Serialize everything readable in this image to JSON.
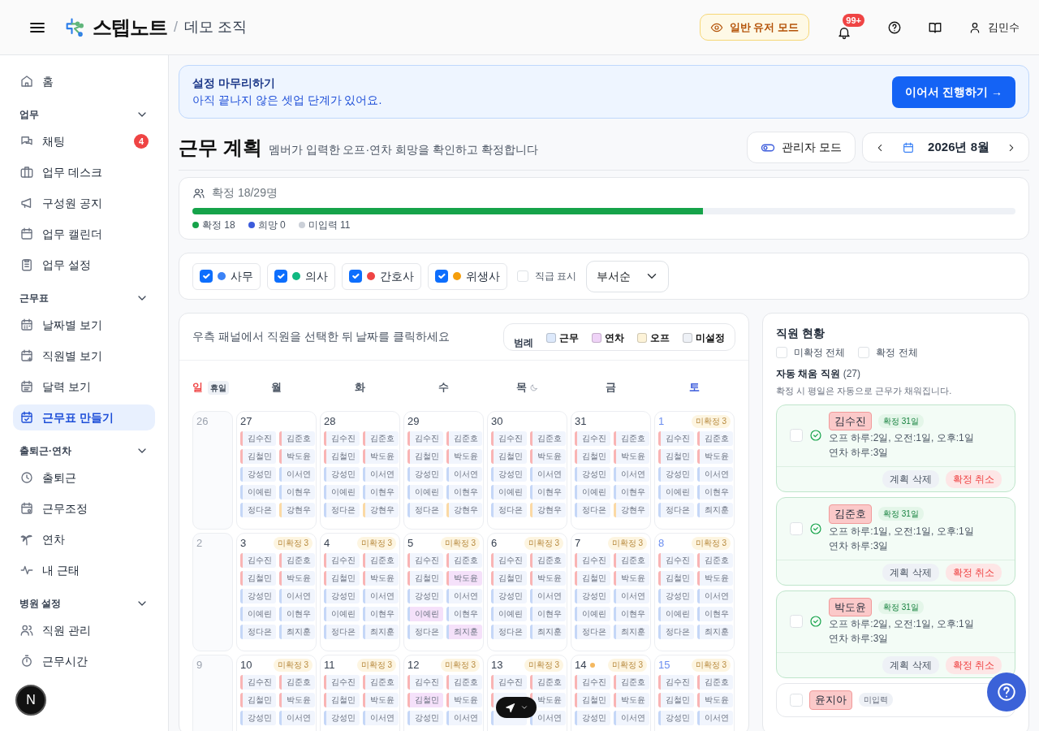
{
  "header": {
    "brand": "스텝노트",
    "separator": "/",
    "org": "데모 조직",
    "mode_button": "일반 유저 모드",
    "notifications": "99+",
    "user": "김민수"
  },
  "sidebar": [
    {
      "items": [
        {
          "label": "홈",
          "selected": false
        }
      ]
    },
    {
      "title": "업무",
      "expanded": true,
      "items": [
        {
          "label": "채팅",
          "selected": false,
          "badge": "4"
        },
        {
          "label": "업무 데스크",
          "selected": false
        },
        {
          "label": "구성원 공지",
          "selected": false
        },
        {
          "label": "업무 캘린더",
          "selected": false
        },
        {
          "label": "업무 설정",
          "selected": false
        }
      ]
    },
    {
      "title": "근무표",
      "expanded": true,
      "items": [
        {
          "label": "날짜별 보기",
          "selected": false
        },
        {
          "label": "직원별 보기",
          "selected": false
        },
        {
          "label": "달력 보기",
          "selected": false
        },
        {
          "label": "근무표 만들기",
          "selected": true
        }
      ]
    },
    {
      "title": "출퇴근·연차",
      "expanded": true,
      "items": [
        {
          "label": "출퇴근",
          "selected": false
        },
        {
          "label": "근무조정",
          "selected": false
        },
        {
          "label": "연차",
          "selected": false
        },
        {
          "label": "내 근태",
          "selected": false
        }
      ]
    },
    {
      "title": "병원 설정",
      "expanded": true,
      "items": [
        {
          "label": "직원 관리",
          "selected": false
        },
        {
          "label": "근무시간",
          "selected": false
        }
      ]
    }
  ],
  "dev_badge": "N",
  "banner": {
    "title": "설정 마무리하기",
    "text": "아직 끝나지 않은 셋업 단계가 있어요.",
    "button": "이어서 진행하기 →"
  },
  "page": {
    "title": "근무 계획",
    "subtitle": "멤버가 입력한 오프·연차 희망을 확인하고 확정합니다",
    "admin_button": "관리자 모드",
    "month": "2026년 8월"
  },
  "progress": {
    "label": "확정 18/29명",
    "level": 0.62,
    "legend": [
      {
        "label": "확정 18",
        "color": "#16a34a"
      },
      {
        "label": "희망 0",
        "color": "#3b5bdb"
      },
      {
        "label": "미입력 11",
        "color": "#cbd0d8"
      }
    ]
  },
  "filters": [
    {
      "label": "사무",
      "color": "#3b82f6",
      "checked": true
    },
    {
      "label": "의사",
      "color": "#10b981",
      "checked": true
    },
    {
      "label": "간호사",
      "color": "#ef4444",
      "checked": true
    },
    {
      "label": "위생사",
      "color": "#f59e0b",
      "checked": true
    }
  ],
  "show_rank": {
    "label": "직급 표시",
    "checked": false
  },
  "sort": "부서순",
  "calendar": {
    "hint": "우측 패널에서 직원을 선택한 뒤 날짜를 클릭하세요",
    "legend_title": "범례",
    "legend": [
      {
        "label": "근무",
        "color": "#dde9fb"
      },
      {
        "label": "연차",
        "color": "#efd3f7"
      },
      {
        "label": "오프",
        "color": "#fdf3d8"
      },
      {
        "label": "미설정",
        "color": "#eef1f6"
      }
    ],
    "weekdays": [
      {
        "label": "일",
        "kind": "sun",
        "tag": "휴일"
      },
      {
        "label": "월",
        "kind": "day"
      },
      {
        "label": "화",
        "kind": "day"
      },
      {
        "label": "수",
        "kind": "day"
      },
      {
        "label": "목",
        "kind": "night"
      },
      {
        "label": "금",
        "kind": "day"
      },
      {
        "label": "토",
        "kind": "sat"
      }
    ],
    "weeks": [
      [
        {
          "date": "26",
          "kind": "sun"
        },
        {
          "date": "27",
          "kind": "day",
          "chips": [
            {
              "name": "김수진",
              "color": "#f9b4b4",
              "kind": "work"
            },
            {
              "name": "김준호",
              "color": "#f9b4b4",
              "kind": "work"
            },
            {
              "name": "김철민",
              "color": "#f9b4b4",
              "kind": "work"
            },
            {
              "name": "박도윤",
              "color": "#f9b4b4",
              "kind": "work"
            },
            {
              "name": "강성민",
              "color": "#c5d7f7",
              "kind": "work"
            },
            {
              "name": "이서연",
              "color": "#c5d7f7",
              "kind": "work"
            },
            {
              "name": "이예린",
              "color": "#c5d7f7",
              "kind": "work"
            },
            {
              "name": "이현우",
              "color": "#c5d7f7",
              "kind": "work"
            },
            {
              "name": "정다은",
              "color": "#c5d7f7",
              "kind": "work"
            },
            {
              "name": "강현우",
              "color": "#fbd9a4",
              "kind": "work"
            }
          ]
        },
        {
          "date": "28",
          "kind": "day",
          "chips": [
            {
              "name": "김수진",
              "color": "#f9b4b4",
              "kind": "work"
            },
            {
              "name": "김준호",
              "color": "#f9b4b4",
              "kind": "work"
            },
            {
              "name": "김철민",
              "color": "#f9b4b4",
              "kind": "work"
            },
            {
              "name": "박도윤",
              "color": "#f9b4b4",
              "kind": "work"
            },
            {
              "name": "강성민",
              "color": "#c5d7f7",
              "kind": "work"
            },
            {
              "name": "이서연",
              "color": "#c5d7f7",
              "kind": "work"
            },
            {
              "name": "이예린",
              "color": "#c5d7f7",
              "kind": "work"
            },
            {
              "name": "이현우",
              "color": "#c5d7f7",
              "kind": "work"
            },
            {
              "name": "정다은",
              "color": "#c5d7f7",
              "kind": "work"
            },
            {
              "name": "강현우",
              "color": "#fbd9a4",
              "kind": "work"
            }
          ]
        },
        {
          "date": "29",
          "kind": "day",
          "chips": [
            {
              "name": "김수진",
              "color": "#f9b4b4",
              "kind": "work"
            },
            {
              "name": "김준호",
              "color": "#f9b4b4",
              "kind": "work"
            },
            {
              "name": "김철민",
              "color": "#f9b4b4",
              "kind": "work"
            },
            {
              "name": "박도윤",
              "color": "#f9b4b4",
              "kind": "work"
            },
            {
              "name": "강성민",
              "color": "#c5d7f7",
              "kind": "work"
            },
            {
              "name": "이서연",
              "color": "#c5d7f7",
              "kind": "work"
            },
            {
              "name": "이예린",
              "color": "#c5d7f7",
              "kind": "work"
            },
            {
              "name": "이현우",
              "color": "#c5d7f7",
              "kind": "work"
            },
            {
              "name": "정다은",
              "color": "#c5d7f7",
              "kind": "work"
            },
            {
              "name": "강현우",
              "color": "#fbd9a4",
              "kind": "work"
            }
          ]
        },
        {
          "date": "30",
          "kind": "day",
          "chips": [
            {
              "name": "김수진",
              "color": "#f9b4b4",
              "kind": "work"
            },
            {
              "name": "김준호",
              "color": "#f9b4b4",
              "kind": "work"
            },
            {
              "name": "김철민",
              "color": "#f9b4b4",
              "kind": "work"
            },
            {
              "name": "박도윤",
              "color": "#f9b4b4",
              "kind": "work"
            },
            {
              "name": "강성민",
              "color": "#c5d7f7",
              "kind": "work"
            },
            {
              "name": "이서연",
              "color": "#c5d7f7",
              "kind": "work"
            },
            {
              "name": "이예린",
              "color": "#c5d7f7",
              "kind": "work"
            },
            {
              "name": "이현우",
              "color": "#c5d7f7",
              "kind": "work"
            },
            {
              "name": "정다은",
              "color": "#c5d7f7",
              "kind": "work"
            },
            {
              "name": "강현우",
              "color": "#fbd9a4",
              "kind": "work"
            }
          ]
        },
        {
          "date": "31",
          "kind": "day",
          "chips": [
            {
              "name": "김수진",
              "color": "#f9b4b4",
              "kind": "work"
            },
            {
              "name": "김준호",
              "color": "#f9b4b4",
              "kind": "work"
            },
            {
              "name": "김철민",
              "color": "#f9b4b4",
              "kind": "work"
            },
            {
              "name": "박도윤",
              "color": "#f9b4b4",
              "kind": "work"
            },
            {
              "name": "강성민",
              "color": "#c5d7f7",
              "kind": "work"
            },
            {
              "name": "이서연",
              "color": "#c5d7f7",
              "kind": "work"
            },
            {
              "name": "이예린",
              "color": "#c5d7f7",
              "kind": "work"
            },
            {
              "name": "이현우",
              "color": "#c5d7f7",
              "kind": "work"
            },
            {
              "name": "정다은",
              "color": "#c5d7f7",
              "kind": "work"
            },
            {
              "name": "강현우",
              "color": "#fbd9a4",
              "kind": "work"
            }
          ]
        },
        {
          "date": "1",
          "kind": "sat",
          "badge": "미확정 3",
          "chips": [
            {
              "name": "김수진",
              "color": "#f9b4b4",
              "kind": "work"
            },
            {
              "name": "김준호",
              "color": "#f9b4b4",
              "kind": "work"
            },
            {
              "name": "김철민",
              "color": "#f9b4b4",
              "kind": "work"
            },
            {
              "name": "박도윤",
              "color": "#f9b4b4",
              "kind": "work"
            },
            {
              "name": "강성민",
              "color": "#c5d7f7",
              "kind": "work"
            },
            {
              "name": "이서연",
              "color": "#c5d7f7",
              "kind": "work"
            },
            {
              "name": "이예린",
              "color": "#c5d7f7",
              "kind": "work"
            },
            {
              "name": "이현우",
              "color": "#c5d7f7",
              "kind": "work"
            },
            {
              "name": "정다은",
              "color": "#c5d7f7",
              "kind": "work"
            },
            {
              "name": "최지훈",
              "color": "#c5d7f7",
              "kind": "work"
            }
          ]
        }
      ],
      [
        {
          "date": "2",
          "kind": "sun"
        },
        {
          "date": "3",
          "kind": "day",
          "badge": "미확정 3",
          "chips": [
            {
              "name": "김수진",
              "color": "#f9b4b4",
              "kind": "work"
            },
            {
              "name": "김준호",
              "color": "#f9b4b4",
              "kind": "work"
            },
            {
              "name": "김철민",
              "color": "#f9b4b4",
              "kind": "work"
            },
            {
              "name": "박도윤",
              "color": "#f9b4b4",
              "kind": "work"
            },
            {
              "name": "강성민",
              "color": "#c5d7f7",
              "kind": "work"
            },
            {
              "name": "이서연",
              "color": "#c5d7f7",
              "kind": "work"
            },
            {
              "name": "이예린",
              "color": "#c5d7f7",
              "kind": "work"
            },
            {
              "name": "이현우",
              "color": "#c5d7f7",
              "kind": "work"
            },
            {
              "name": "정다은",
              "color": "#c5d7f7",
              "kind": "work"
            },
            {
              "name": "최지훈",
              "color": "#c5d7f7",
              "kind": "work"
            }
          ]
        },
        {
          "date": "4",
          "kind": "day",
          "badge": "미확정 3",
          "chips": [
            {
              "name": "김수진",
              "color": "#f9b4b4",
              "kind": "work"
            },
            {
              "name": "김준호",
              "color": "#f9b4b4",
              "kind": "work"
            },
            {
              "name": "김철민",
              "color": "#f9b4b4",
              "kind": "work"
            },
            {
              "name": "박도윤",
              "color": "#f9b4b4",
              "kind": "work"
            },
            {
              "name": "강성민",
              "color": "#c5d7f7",
              "kind": "work"
            },
            {
              "name": "이서연",
              "color": "#c5d7f7",
              "kind": "work"
            },
            {
              "name": "이예린",
              "color": "#c5d7f7",
              "kind": "work"
            },
            {
              "name": "이현우",
              "color": "#c5d7f7",
              "kind": "work"
            },
            {
              "name": "정다은",
              "color": "#c5d7f7",
              "kind": "work"
            },
            {
              "name": "최지훈",
              "color": "#c5d7f7",
              "kind": "work"
            }
          ]
        },
        {
          "date": "5",
          "kind": "day",
          "badge": "미확정 3",
          "chips": [
            {
              "name": "김수진",
              "color": "#f9b4b4",
              "kind": "work"
            },
            {
              "name": "김준호",
              "color": "#f9b4b4",
              "kind": "work"
            },
            {
              "name": "김철민",
              "color": "#f9b4b4",
              "kind": "work"
            },
            {
              "name": "박도윤",
              "color": "#f9b4b4",
              "kind": "leave"
            },
            {
              "name": "강성민",
              "color": "#c5d7f7",
              "kind": "work"
            },
            {
              "name": "이서연",
              "color": "#c5d7f7",
              "kind": "work"
            },
            {
              "name": "이예린",
              "color": "#c5d7f7",
              "kind": "leave"
            },
            {
              "name": "이현우",
              "color": "#c5d7f7",
              "kind": "work"
            },
            {
              "name": "정다은",
              "color": "#c5d7f7",
              "kind": "work"
            },
            {
              "name": "최지훈",
              "color": "#c5d7f7",
              "kind": "leave"
            }
          ]
        },
        {
          "date": "6",
          "kind": "day",
          "badge": "미확정 3",
          "chips": [
            {
              "name": "김수진",
              "color": "#f9b4b4",
              "kind": "work"
            },
            {
              "name": "김준호",
              "color": "#f9b4b4",
              "kind": "work"
            },
            {
              "name": "김철민",
              "color": "#f9b4b4",
              "kind": "work"
            },
            {
              "name": "박도윤",
              "color": "#f9b4b4",
              "kind": "work"
            },
            {
              "name": "강성민",
              "color": "#c5d7f7",
              "kind": "work"
            },
            {
              "name": "이서연",
              "color": "#c5d7f7",
              "kind": "work"
            },
            {
              "name": "이예린",
              "color": "#c5d7f7",
              "kind": "work"
            },
            {
              "name": "이현우",
              "color": "#c5d7f7",
              "kind": "work"
            },
            {
              "name": "정다은",
              "color": "#c5d7f7",
              "kind": "work"
            },
            {
              "name": "최지훈",
              "color": "#c5d7f7",
              "kind": "work"
            }
          ]
        },
        {
          "date": "7",
          "kind": "day",
          "badge": "미확정 3",
          "chips": [
            {
              "name": "김수진",
              "color": "#f9b4b4",
              "kind": "work"
            },
            {
              "name": "김준호",
              "color": "#f9b4b4",
              "kind": "work"
            },
            {
              "name": "김철민",
              "color": "#f9b4b4",
              "kind": "work"
            },
            {
              "name": "박도윤",
              "color": "#f9b4b4",
              "kind": "work"
            },
            {
              "name": "강성민",
              "color": "#c5d7f7",
              "kind": "work"
            },
            {
              "name": "이서연",
              "color": "#c5d7f7",
              "kind": "work"
            },
            {
              "name": "이예린",
              "color": "#c5d7f7",
              "kind": "work"
            },
            {
              "name": "이현우",
              "color": "#c5d7f7",
              "kind": "work"
            },
            {
              "name": "정다은",
              "color": "#c5d7f7",
              "kind": "work"
            },
            {
              "name": "최지훈",
              "color": "#c5d7f7",
              "kind": "work"
            }
          ]
        },
        {
          "date": "8",
          "kind": "sat",
          "badge": "미확정 3",
          "chips": [
            {
              "name": "김수진",
              "color": "#f9b4b4",
              "kind": "work"
            },
            {
              "name": "김준호",
              "color": "#f9b4b4",
              "kind": "work"
            },
            {
              "name": "김철민",
              "color": "#f9b4b4",
              "kind": "work"
            },
            {
              "name": "박도윤",
              "color": "#f9b4b4",
              "kind": "work"
            },
            {
              "name": "강성민",
              "color": "#c5d7f7",
              "kind": "work"
            },
            {
              "name": "이서연",
              "color": "#c5d7f7",
              "kind": "work"
            },
            {
              "name": "이예린",
              "color": "#c5d7f7",
              "kind": "work"
            },
            {
              "name": "이현우",
              "color": "#c5d7f7",
              "kind": "work"
            },
            {
              "name": "정다은",
              "color": "#c5d7f7",
              "kind": "work"
            },
            {
              "name": "최지훈",
              "color": "#c5d7f7",
              "kind": "work"
            }
          ]
        }
      ],
      [
        {
          "date": "9",
          "kind": "sun"
        },
        {
          "date": "10",
          "kind": "day",
          "badge": "미확정 3",
          "chips": [
            {
              "name": "김수진",
              "color": "#f9b4b4",
              "kind": "work"
            },
            {
              "name": "김준호",
              "color": "#f9b4b4",
              "kind": "work"
            },
            {
              "name": "김철민",
              "color": "#f9b4b4",
              "kind": "work"
            },
            {
              "name": "박도윤",
              "color": "#f9b4b4",
              "kind": "work"
            },
            {
              "name": "강성민",
              "color": "#c5d7f7",
              "kind": "work"
            },
            {
              "name": "이서연",
              "color": "#c5d7f7",
              "kind": "work"
            }
          ]
        },
        {
          "date": "11",
          "kind": "day",
          "badge": "미확정 3",
          "chips": [
            {
              "name": "김수진",
              "color": "#f9b4b4",
              "kind": "work"
            },
            {
              "name": "김준호",
              "color": "#f9b4b4",
              "kind": "work"
            },
            {
              "name": "김철민",
              "color": "#f9b4b4",
              "kind": "work"
            },
            {
              "name": "박도윤",
              "color": "#f9b4b4",
              "kind": "work"
            },
            {
              "name": "강성민",
              "color": "#c5d7f7",
              "kind": "work"
            },
            {
              "name": "이서연",
              "color": "#c5d7f7",
              "kind": "work"
            }
          ]
        },
        {
          "date": "12",
          "kind": "day",
          "badge": "미확정 3",
          "chips": [
            {
              "name": "김수진",
              "color": "#f9b4b4",
              "kind": "work"
            },
            {
              "name": "김준호",
              "color": "#f9b4b4",
              "kind": "work"
            },
            {
              "name": "김철민",
              "color": "#f9b4b4",
              "kind": "leave"
            },
            {
              "name": "박도윤",
              "color": "#f9b4b4",
              "kind": "work"
            },
            {
              "name": "강성민",
              "color": "#c5d7f7",
              "kind": "work"
            },
            {
              "name": "이서연",
              "color": "#c5d7f7",
              "kind": "work"
            }
          ]
        },
        {
          "date": "13",
          "kind": "day",
          "badge": "미확정 3",
          "chips": [
            {
              "name": "김수진",
              "color": "#f9b4b4",
              "kind": "work"
            },
            {
              "name": "김준호",
              "color": "#f9b4b4",
              "kind": "work"
            },
            {
              "color": "#f9b4b4",
              "kind": "work"
            },
            {
              "name": "박도윤",
              "color": "#f9b4b4",
              "kind": "work"
            },
            {
              "color": "#c5d7f7",
              "kind": "work"
            },
            {
              "name": "이서연",
              "color": "#c5d7f7",
              "kind": "work"
            }
          ]
        },
        {
          "date": "14",
          "kind": "day",
          "badge": "미확정 3",
          "note_dot": true,
          "chips": [
            {
              "name": "김수진",
              "color": "#f9b4b4",
              "kind": "work"
            },
            {
              "name": "김준호",
              "color": "#f9b4b4",
              "kind": "work"
            },
            {
              "name": "김철민",
              "color": "#f9b4b4",
              "kind": "work"
            },
            {
              "name": "박도윤",
              "color": "#f9b4b4",
              "kind": "work"
            },
            {
              "name": "강성민",
              "color": "#c5d7f7",
              "kind": "work"
            },
            {
              "name": "이서연",
              "color": "#c5d7f7",
              "kind": "work"
            }
          ]
        },
        {
          "date": "15",
          "kind": "sat",
          "badge": "미확정 3",
          "chips": [
            {
              "name": "김수진",
              "color": "#f9b4b4",
              "kind": "work"
            },
            {
              "name": "김준호",
              "color": "#f9b4b4",
              "kind": "work"
            },
            {
              "name": "김철민",
              "color": "#f9b4b4",
              "kind": "work"
            },
            {
              "name": "박도윤",
              "color": "#f9b4b4",
              "kind": "work"
            },
            {
              "name": "강성민",
              "color": "#c5d7f7",
              "kind": "work"
            },
            {
              "name": "이서연",
              "color": "#c5d7f7",
              "kind": "work"
            }
          ]
        }
      ]
    ]
  },
  "staff_panel": {
    "title": "직원 현황",
    "toggles": [
      {
        "label": "미확정 전체",
        "checked": false
      },
      {
        "label": "확정 전체",
        "checked": false
      }
    ],
    "group_title": "자동 채움 직원",
    "group_count": "(27)",
    "note": "확정 시 평일은 자동으로 근무가 채워집니다.",
    "staff": [
      {
        "name": "김수진",
        "status": "확정 31일",
        "confirmed": true,
        "checked": false,
        "lines": [
          "오프 하루:2일, 오전:1일, 오후:1일",
          "연차 하루:3일"
        ],
        "actions": [
          "계획 삭제",
          "확정 취소"
        ]
      },
      {
        "name": "김준호",
        "status": "확정 31일",
        "confirmed": true,
        "checked": false,
        "lines": [
          "오프 하루:1일, 오전:1일, 오후:1일",
          "연차 하루:3일"
        ],
        "actions": [
          "계획 삭제",
          "확정 취소"
        ]
      },
      {
        "name": "박도윤",
        "status": "확정 31일",
        "confirmed": true,
        "checked": false,
        "lines": [
          "오프 하루:2일, 오전:1일, 오후:1일",
          "연차 하루:3일"
        ],
        "actions": [
          "계획 삭제",
          "확정 취소"
        ]
      },
      {
        "name": "윤지아",
        "status": "미입력",
        "confirmed": false,
        "checked": false
      }
    ]
  }
}
